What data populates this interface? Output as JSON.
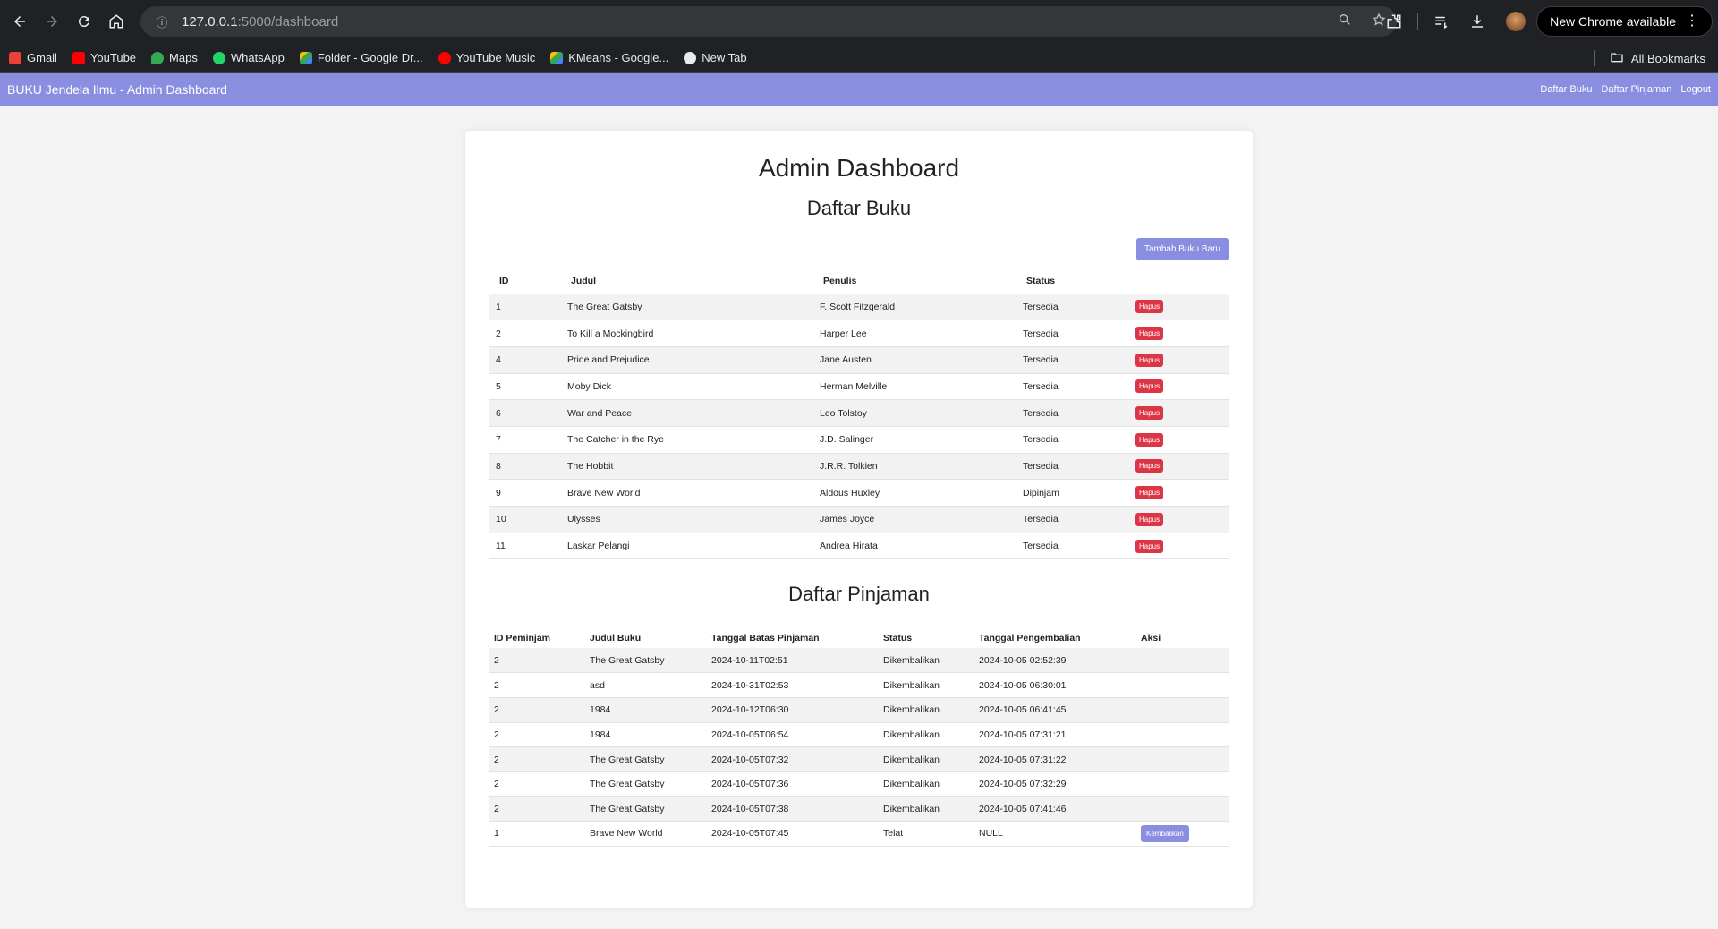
{
  "browser": {
    "url_host": "127.0.0.1",
    "url_path": ":5000/dashboard",
    "new_chrome_label": "New Chrome available",
    "bookmarks": [
      {
        "label": "Gmail",
        "icon": "gmail-icon",
        "color": "#ea4335"
      },
      {
        "label": "YouTube",
        "icon": "youtube-icon",
        "color": "#ff0000"
      },
      {
        "label": "Maps",
        "icon": "maps-icon",
        "color": "#34a853"
      },
      {
        "label": "WhatsApp",
        "icon": "whatsapp-icon",
        "color": "#25d366"
      },
      {
        "label": "Folder - Google Dr...",
        "icon": "google-drive-icon",
        "color": "#fbbc04"
      },
      {
        "label": "YouTube Music",
        "icon": "youtube-music-icon",
        "color": "#ff0000"
      },
      {
        "label": "KMeans - Google...",
        "icon": "google-drive-icon",
        "color": "#fbbc04"
      },
      {
        "label": "New Tab",
        "icon": "globe-icon",
        "color": "#e8eaed"
      }
    ],
    "all_bookmarks_label": "All Bookmarks"
  },
  "navbar": {
    "brand": "BUKU Jendela Ilmu - Admin Dashboard",
    "links": [
      "Daftar Buku",
      "Daftar Pinjaman",
      "Logout"
    ],
    "accent": "#8a8ee0"
  },
  "page": {
    "title": "Admin Dashboard",
    "buku_heading": "Daftar Buku",
    "add_button": "Tambah Buku Baru",
    "buku_columns": [
      "ID",
      "Judul",
      "Penulis",
      "Status"
    ],
    "hapus_label": "Hapus",
    "books": [
      {
        "id": "1",
        "judul": "The Great Gatsby",
        "penulis": "F. Scott Fitzgerald",
        "status": "Tersedia"
      },
      {
        "id": "2",
        "judul": "To Kill a Mockingbird",
        "penulis": "Harper Lee",
        "status": "Tersedia"
      },
      {
        "id": "4",
        "judul": "Pride and Prejudice",
        "penulis": "Jane Austen",
        "status": "Tersedia"
      },
      {
        "id": "5",
        "judul": "Moby Dick",
        "penulis": "Herman Melville",
        "status": "Tersedia"
      },
      {
        "id": "6",
        "judul": "War and Peace",
        "penulis": "Leo Tolstoy",
        "status": "Tersedia"
      },
      {
        "id": "7",
        "judul": "The Catcher in the Rye",
        "penulis": "J.D. Salinger",
        "status": "Tersedia"
      },
      {
        "id": "8",
        "judul": "The Hobbit",
        "penulis": "J.R.R. Tolkien",
        "status": "Tersedia"
      },
      {
        "id": "9",
        "judul": "Brave New World",
        "penulis": "Aldous Huxley",
        "status": "Dipinjam"
      },
      {
        "id": "10",
        "judul": "Ulysses",
        "penulis": "James Joyce",
        "status": "Tersedia"
      },
      {
        "id": "11",
        "judul": "Laskar Pelangi",
        "penulis": "Andrea Hirata",
        "status": "Tersedia"
      }
    ],
    "pinjam_heading": "Daftar Pinjaman",
    "pinjam_columns": [
      "ID Peminjam",
      "Judul Buku",
      "Tanggal Batas Pinjaman",
      "Status",
      "Tanggal Pengembalian",
      "Aksi"
    ],
    "kembali_label": "Kembalikan",
    "loans": [
      {
        "id": "2",
        "judul": "The Great Gatsby",
        "batas": "2024-10-11T02:51",
        "status": "Dikembalikan",
        "kembali": "2024-10-05 02:52:39",
        "action": false
      },
      {
        "id": "2",
        "judul": "asd",
        "batas": "2024-10-31T02:53",
        "status": "Dikembalikan",
        "kembali": "2024-10-05 06:30:01",
        "action": false
      },
      {
        "id": "2",
        "judul": "1984",
        "batas": "2024-10-12T06:30",
        "status": "Dikembalikan",
        "kembali": "2024-10-05 06:41:45",
        "action": false
      },
      {
        "id": "2",
        "judul": "1984",
        "batas": "2024-10-05T06:54",
        "status": "Dikembalikan",
        "kembali": "2024-10-05 07:31:21",
        "action": false
      },
      {
        "id": "2",
        "judul": "The Great Gatsby",
        "batas": "2024-10-05T07:32",
        "status": "Dikembalikan",
        "kembali": "2024-10-05 07:31:22",
        "action": false
      },
      {
        "id": "2",
        "judul": "The Great Gatsby",
        "batas": "2024-10-05T07:36",
        "status": "Dikembalikan",
        "kembali": "2024-10-05 07:32:29",
        "action": false
      },
      {
        "id": "2",
        "judul": "The Great Gatsby",
        "batas": "2024-10-05T07:38",
        "status": "Dikembalikan",
        "kembali": "2024-10-05 07:41:46",
        "action": false
      },
      {
        "id": "1",
        "judul": "Brave New World",
        "batas": "2024-10-05T07:45",
        "status": "Telat",
        "kembali": "NULL",
        "action": true
      }
    ]
  }
}
